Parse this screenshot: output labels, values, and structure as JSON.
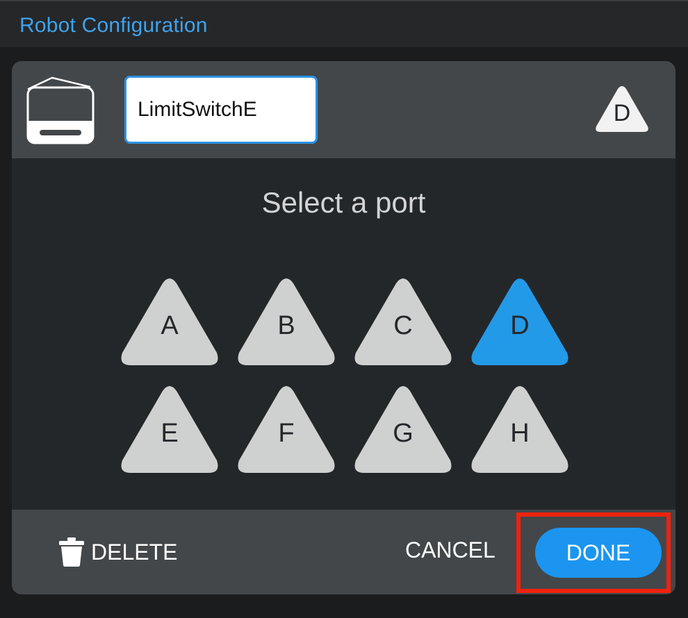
{
  "title_bar": {
    "title": "Robot Configuration"
  },
  "dialog": {
    "device_icon": "limit-switch-device-icon",
    "name_value": "LimitSwitchE",
    "selected_port_badge": "D",
    "select_title": "Select a port",
    "ports": [
      {
        "label": "A",
        "selected": false
      },
      {
        "label": "B",
        "selected": false
      },
      {
        "label": "C",
        "selected": false
      },
      {
        "label": "D",
        "selected": true
      },
      {
        "label": "E",
        "selected": false
      },
      {
        "label": "F",
        "selected": false
      },
      {
        "label": "G",
        "selected": false
      },
      {
        "label": "H",
        "selected": false
      }
    ],
    "footer": {
      "delete_label": "DELETE",
      "delete_icon": "trash-icon",
      "cancel_label": "CANCEL",
      "done_label": "DONE"
    }
  },
  "colors": {
    "accent": "#1b95f0",
    "title_blue": "#3fa3ee",
    "port_default": "#cfd0d0",
    "port_selected": "#239ae8",
    "highlight_box": "#f0220e"
  }
}
